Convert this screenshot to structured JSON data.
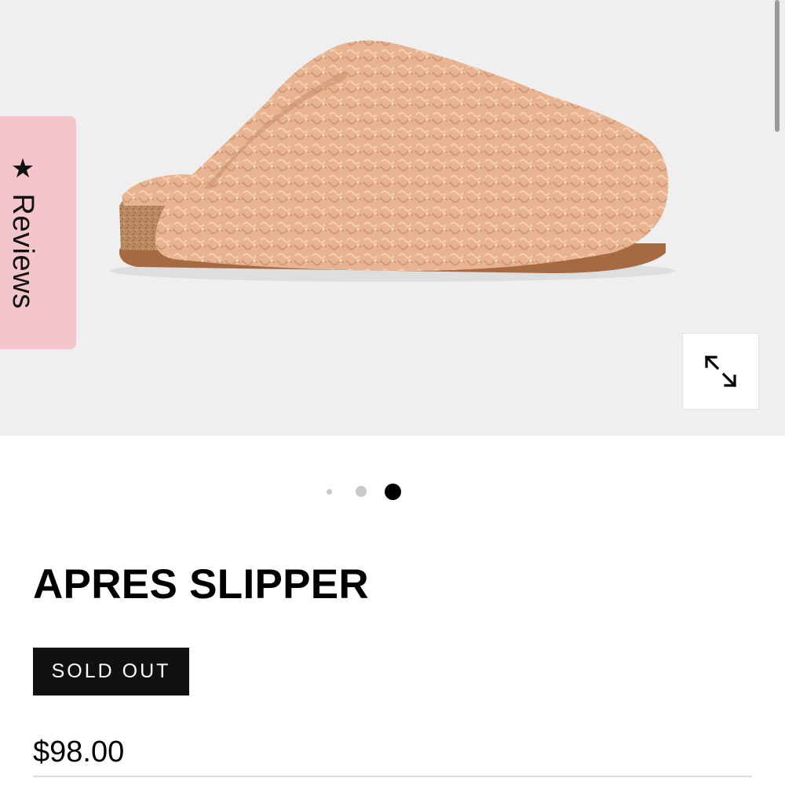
{
  "gallery": {
    "image_label": "Apres slipper product photo",
    "reviews_tab": {
      "star_icon": "star-icon",
      "label": "Reviews"
    },
    "expand_icon": "expand-arrows-icon",
    "slide_count": 3,
    "active_slide": 3
  },
  "product": {
    "title": "APRES SLIPPER",
    "badge": "SOLD OUT",
    "price": "$98.00"
  },
  "colors": {
    "reviews_tab_bg": "#f4c6cb",
    "badge_bg": "#111111",
    "gallery_bg": "#efefef",
    "slipper_fleece": "#e6b08e"
  }
}
